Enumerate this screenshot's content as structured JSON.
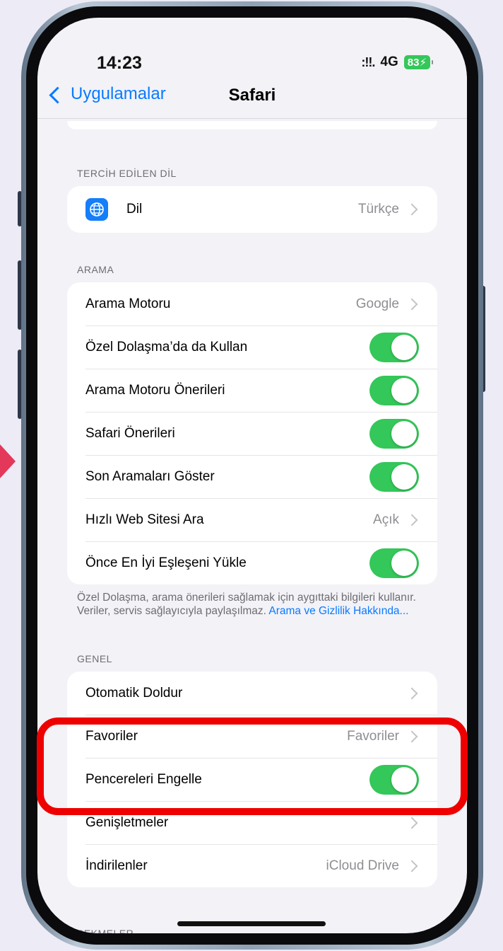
{
  "status_bar": {
    "time": "14:23",
    "signal": ":!!.",
    "network": "4G",
    "battery": "83"
  },
  "nav": {
    "back_label": "Uygulamalar",
    "title": "Safari"
  },
  "sections": {
    "language": {
      "header": "TERCİH EDİLEN DİL",
      "row": {
        "label": "Dil",
        "value": "Türkçe"
      }
    },
    "search": {
      "header": "ARAMA",
      "rows": [
        {
          "label": "Arama Motoru",
          "value": "Google"
        },
        {
          "label": "Özel Dolaşma’da da Kullan",
          "toggle": true
        },
        {
          "label": "Arama Motoru Önerileri",
          "toggle": true
        },
        {
          "label": "Safari Önerileri",
          "toggle": true
        },
        {
          "label": "Son Aramaları Göster",
          "toggle": true
        },
        {
          "label": "Hızlı Web Sitesi Ara",
          "value": "Açık"
        },
        {
          "label": "Önce En İyi Eşleşeni Yükle",
          "toggle": true
        }
      ],
      "footer_text": "Özel Dolaşma, arama önerileri sağlamak için aygıttaki bilgileri kullanır. Veriler, servis sağlayıcıyla paylaşılmaz.",
      "footer_link": "Arama ve Gizlilik Hakkında..."
    },
    "general": {
      "header": "GENEL",
      "rows": [
        {
          "label": "Otomatik Doldur"
        },
        {
          "label": "Favoriler",
          "value": "Favoriler"
        },
        {
          "label": "Pencereleri Engelle",
          "toggle": true
        },
        {
          "label": "Genişletmeler"
        },
        {
          "label": "İndirilenler",
          "value": "iCloud Drive"
        }
      ]
    },
    "tabs": {
      "header": "SEKMELER"
    }
  },
  "colors": {
    "accent": "#0a7aff",
    "toggle_on": "#34c759",
    "highlight": "#ef0000",
    "pointer": "#e3385a"
  }
}
